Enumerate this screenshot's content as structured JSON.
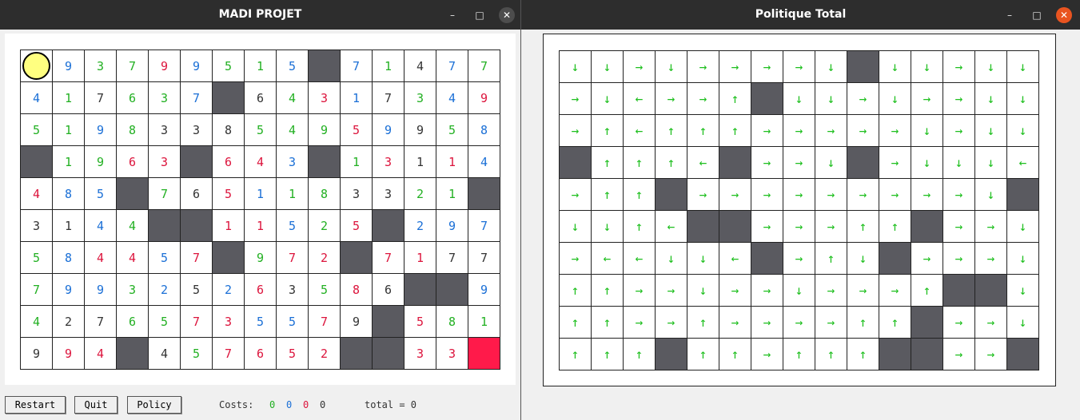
{
  "window1": {
    "title": "MADI PROJET",
    "grid": [
      [
        "A",
        "9",
        "3",
        "7",
        "9",
        "9",
        "5",
        "1",
        "5",
        "W",
        "7",
        "1",
        "4",
        "7",
        "7"
      ],
      [
        "4",
        "1",
        "7",
        "6",
        "3",
        "7",
        "W",
        "6",
        "4",
        "3",
        "1",
        "7",
        "3",
        "4",
        "9"
      ],
      [
        "5",
        "1",
        "9",
        "8",
        "3",
        "3",
        "8",
        "5",
        "4",
        "9",
        "5",
        "9",
        "9",
        "5",
        "8"
      ],
      [
        "W",
        "1",
        "9",
        "6",
        "3",
        "W",
        "6",
        "4",
        "3",
        "W",
        "1",
        "3",
        "1",
        "1",
        "4"
      ],
      [
        "4",
        "8",
        "5",
        "W",
        "7",
        "6",
        "5",
        "1",
        "1",
        "8",
        "3",
        "3",
        "2",
        "1",
        "W"
      ],
      [
        "3",
        "1",
        "4",
        "4",
        "W",
        "W",
        "1",
        "1",
        "5",
        "2",
        "5",
        "W",
        "2",
        "9",
        "7"
      ],
      [
        "5",
        "8",
        "4",
        "4",
        "5",
        "7",
        "W",
        "9",
        "7",
        "2",
        "W",
        "7",
        "1",
        "7",
        "7"
      ],
      [
        "7",
        "9",
        "9",
        "3",
        "2",
        "5",
        "2",
        "6",
        "3",
        "5",
        "8",
        "6",
        "W",
        "W",
        "9"
      ],
      [
        "4",
        "2",
        "7",
        "6",
        "5",
        "7",
        "3",
        "5",
        "5",
        "7",
        "9",
        "W",
        "5",
        "8",
        "1"
      ],
      [
        "9",
        "9",
        "4",
        "W",
        "4",
        "5",
        "7",
        "6",
        "5",
        "2",
        "W",
        "W",
        "3",
        "3",
        "G"
      ]
    ],
    "colors": [
      [
        "",
        "b",
        "g",
        "g",
        "r",
        "b",
        "g",
        "g",
        "b",
        "",
        "b",
        "g",
        "k",
        "b",
        "g"
      ],
      [
        "b",
        "g",
        "k",
        "g",
        "g",
        "b",
        "",
        "k",
        "g",
        "r",
        "b",
        "k",
        "g",
        "b",
        "r"
      ],
      [
        "g",
        "g",
        "b",
        "g",
        "k",
        "k",
        "k",
        "g",
        "g",
        "g",
        "r",
        "b",
        "k",
        "g",
        "b"
      ],
      [
        "",
        "g",
        "g",
        "r",
        "r",
        "",
        "r",
        "r",
        "b",
        "",
        "g",
        "r",
        "k",
        "r",
        "b"
      ],
      [
        "r",
        "b",
        "b",
        "",
        "g",
        "k",
        "r",
        "b",
        "g",
        "g",
        "k",
        "k",
        "g",
        "g",
        ""
      ],
      [
        "k",
        "k",
        "b",
        "g",
        "",
        "",
        "r",
        "r",
        "b",
        "g",
        "r",
        "",
        "b",
        "b",
        "b"
      ],
      [
        "g",
        "b",
        "r",
        "r",
        "b",
        "r",
        "",
        "g",
        "r",
        "r",
        "",
        "r",
        "r",
        "k",
        "k"
      ],
      [
        "g",
        "b",
        "b",
        "g",
        "b",
        "k",
        "b",
        "r",
        "k",
        "g",
        "r",
        "k",
        "",
        "",
        "b"
      ],
      [
        "g",
        "k",
        "k",
        "g",
        "g",
        "r",
        "r",
        "b",
        "b",
        "r",
        "k",
        "",
        "r",
        "g",
        "g"
      ],
      [
        "k",
        "r",
        "r",
        "",
        "k",
        "g",
        "r",
        "r",
        "r",
        "r",
        "",
        "",
        "r",
        "r",
        ""
      ]
    ],
    "palette": {
      "g": "#22b022",
      "b": "#1a6fd6",
      "r": "#dc143c",
      "k": "#333333"
    },
    "buttons": {
      "restart": "Restart",
      "quit": "Quit",
      "policy": "Policy"
    },
    "costs_label": "Costs:",
    "costs": [
      {
        "value": "0",
        "color": "#22b022"
      },
      {
        "value": "0",
        "color": "#1a6fd6"
      },
      {
        "value": "0",
        "color": "#dc143c"
      },
      {
        "value": "0",
        "color": "#333333"
      }
    ],
    "total_label": "total = 0"
  },
  "window2": {
    "title": "Politique Total",
    "policy": [
      [
        "D",
        "D",
        "R",
        "D",
        "R",
        "R",
        "R",
        "R",
        "D",
        "W",
        "D",
        "D",
        "R",
        "D",
        "D"
      ],
      [
        "R",
        "D",
        "L",
        "R",
        "R",
        "U",
        "W",
        "D",
        "D",
        "R",
        "D",
        "R",
        "R",
        "D",
        "D"
      ],
      [
        "R",
        "U",
        "L",
        "U",
        "U",
        "U",
        "R",
        "R",
        "R",
        "R",
        "R",
        "D",
        "R",
        "D",
        "D"
      ],
      [
        "W",
        "U",
        "U",
        "U",
        "L",
        "W",
        "R",
        "R",
        "D",
        "W",
        "R",
        "D",
        "D",
        "D",
        "L"
      ],
      [
        "R",
        "U",
        "U",
        "W",
        "R",
        "R",
        "R",
        "R",
        "R",
        "R",
        "R",
        "R",
        "R",
        "D",
        "W"
      ],
      [
        "D",
        "D",
        "U",
        "L",
        "W",
        "W",
        "R",
        "R",
        "R",
        "U",
        "U",
        "W",
        "R",
        "R",
        "D"
      ],
      [
        "R",
        "L",
        "L",
        "D",
        "D",
        "L",
        "W",
        "R",
        "U",
        "D",
        "W",
        "R",
        "R",
        "R",
        "D"
      ],
      [
        "U",
        "U",
        "R",
        "R",
        "D",
        "R",
        "R",
        "D",
        "R",
        "R",
        "R",
        "U",
        "W",
        "W",
        "D"
      ],
      [
        "U",
        "U",
        "R",
        "R",
        "U",
        "R",
        "R",
        "R",
        "R",
        "U",
        "U",
        "W",
        "R",
        "R",
        "D"
      ],
      [
        "U",
        "U",
        "U",
        "W",
        "U",
        "U",
        "R",
        "U",
        "U",
        "U",
        "W",
        "W",
        "R",
        "R",
        "W"
      ]
    ],
    "arrows": {
      "U": "↑",
      "D": "↓",
      "L": "←",
      "R": "→"
    }
  }
}
